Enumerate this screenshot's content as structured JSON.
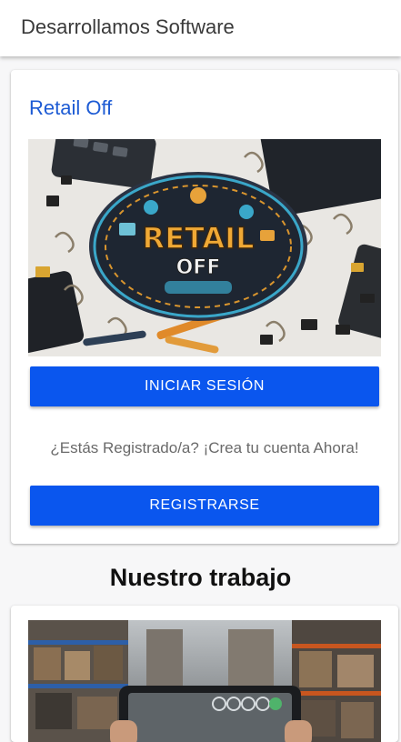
{
  "appbar": {
    "title": "Desarrollamos Software"
  },
  "login_card": {
    "title": "Retail Off",
    "logo": {
      "line1": "RETAIL",
      "line2": "OFF"
    },
    "login_button": "INICIAR SESIÓN",
    "prompt": "¿Estás Registrado/a? ¡Crea tu cuenta Ahora!",
    "register_button": "REGISTRARSE"
  },
  "section": {
    "title": "Nuestro trabajo"
  },
  "colors": {
    "accent_blue": "#0a56ee",
    "title_blue": "#1d5bd4",
    "appbar_bg": "#ffffff",
    "page_bg": "#f7f7f8"
  }
}
